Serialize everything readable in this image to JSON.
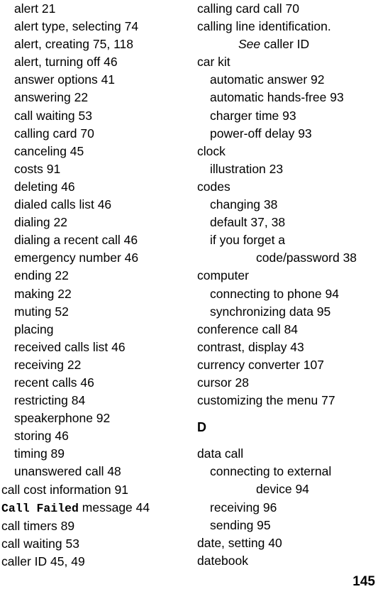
{
  "document": {
    "page_number": "145",
    "type": "index"
  },
  "columns": [
    {
      "id": "left",
      "entries": [
        {
          "level": 1,
          "text": "alert  21"
        },
        {
          "level": 1,
          "text": "alert type, selecting  74"
        },
        {
          "level": 1,
          "text": "alert, creating  75, 118"
        },
        {
          "level": 1,
          "text": "alert, turning off  46"
        },
        {
          "level": 1,
          "text": "answer options  41"
        },
        {
          "level": 1,
          "text": "answering  22"
        },
        {
          "level": 1,
          "text": "call waiting  53"
        },
        {
          "level": 1,
          "text": "calling card  70"
        },
        {
          "level": 1,
          "text": "canceling  45"
        },
        {
          "level": 1,
          "text": "costs  91"
        },
        {
          "level": 1,
          "text": "deleting  46"
        },
        {
          "level": 1,
          "text": "dialed calls list  46"
        },
        {
          "level": 1,
          "text": "dialing  22"
        },
        {
          "level": 1,
          "text": "dialing a recent call  46"
        },
        {
          "level": 1,
          "text": "emergency number  46"
        },
        {
          "level": 1,
          "text": "ending  22"
        },
        {
          "level": 1,
          "text": "making  22"
        },
        {
          "level": 1,
          "text": "muting  52"
        },
        {
          "level": 1,
          "text": "placing"
        },
        {
          "level": 1,
          "text": "received calls list  46"
        },
        {
          "level": 1,
          "text": "receiving  22"
        },
        {
          "level": 1,
          "text": "recent calls  46"
        },
        {
          "level": 1,
          "text": "restricting  84"
        },
        {
          "level": 1,
          "text": "speakerphone  92"
        },
        {
          "level": 1,
          "text": "storing  46"
        },
        {
          "level": 1,
          "text": "timing  89"
        },
        {
          "level": 1,
          "text": "unanswered call  48"
        },
        {
          "level": 0,
          "text": "call cost information  91"
        },
        {
          "level": 0,
          "style": "mono-lead",
          "lead": "Call Failed",
          "text": " message  44"
        },
        {
          "level": 0,
          "text": "call timers  89"
        },
        {
          "level": 0,
          "text": "call waiting  53"
        },
        {
          "level": 0,
          "text": "caller ID  45, 49"
        }
      ]
    },
    {
      "id": "right",
      "entries": [
        {
          "level": 0,
          "text": "calling card call  70"
        },
        {
          "level": 0,
          "text": "calling line identification."
        },
        {
          "level": 2,
          "style": "italic-lead",
          "lead": "See",
          "text": " caller ID"
        },
        {
          "level": 0,
          "text": "car kit"
        },
        {
          "level": 1,
          "text": "automatic answer  92"
        },
        {
          "level": 1,
          "text": "automatic hands-free  93"
        },
        {
          "level": 1,
          "text": "charger time  93"
        },
        {
          "level": 1,
          "text": "power-off delay  93"
        },
        {
          "level": 0,
          "text": "clock"
        },
        {
          "level": 1,
          "text": "illustration  23"
        },
        {
          "level": 0,
          "text": "codes"
        },
        {
          "level": 1,
          "text": "changing  38"
        },
        {
          "level": 1,
          "text": "default  37, 38"
        },
        {
          "level": 1,
          "text": "if you forget a"
        },
        {
          "level": 3,
          "text": "code/password  38"
        },
        {
          "level": 0,
          "text": "computer"
        },
        {
          "level": 1,
          "text": "connecting to phone  94"
        },
        {
          "level": 1,
          "text": "synchronizing data  95"
        },
        {
          "level": 0,
          "text": "conference call  84"
        },
        {
          "level": 0,
          "text": "contrast, display  43"
        },
        {
          "level": 0,
          "text": "currency converter  107"
        },
        {
          "level": 0,
          "text": "cursor  28"
        },
        {
          "level": 0,
          "text": "customizing the menu  77"
        },
        {
          "type": "section",
          "text": "D"
        },
        {
          "level": 0,
          "text": "data call"
        },
        {
          "level": 1,
          "text": "connecting to external"
        },
        {
          "level": 3,
          "text": "device  94"
        },
        {
          "level": 1,
          "text": "receiving  96"
        },
        {
          "level": 1,
          "text": "sending  95"
        },
        {
          "level": 0,
          "text": "date, setting  40"
        },
        {
          "level": 0,
          "text": "datebook"
        }
      ]
    }
  ]
}
